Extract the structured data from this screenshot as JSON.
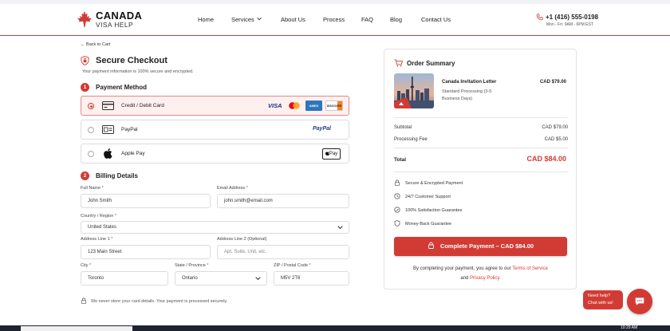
{
  "header": {
    "logo_line1": "CANADA",
    "logo_line2": "VISA HELP",
    "nav": [
      "Home",
      "Services",
      "About Us",
      "Process",
      "FAQ",
      "Blog",
      "Contact Us"
    ],
    "phone": "+1 (416) 555-0198",
    "hours": "Mon - Fri: 9AM - 6PM EST"
  },
  "checkout": {
    "back_label": "← Back to Cart",
    "title": "Secure Checkout",
    "subtitle": "Your payment information is 100% secure and encrypted.",
    "step1_num": "1",
    "step1_label": "Payment Method",
    "methods": [
      {
        "label": "Credit / Debit Card",
        "selected": true
      },
      {
        "label": "PayPal",
        "selected": false
      },
      {
        "label": "Apple Pay",
        "selected": false
      }
    ],
    "brands": {
      "visa": "VISA",
      "amex": "AMEX",
      "discover": "DISCOVER",
      "paypal": "PayPal",
      "applepay": "Pay"
    },
    "step2_num": "2",
    "step2_label": "Billing Details",
    "fields": {
      "full_name": {
        "label": "Full Name",
        "value": "John Smith"
      },
      "email": {
        "label": "Email Address",
        "value": "john.smith@email.com"
      },
      "country": {
        "label": "Country / Region",
        "value": "United States"
      },
      "address1": {
        "label": "Address Line 1",
        "value": "123 Main Street"
      },
      "address2": {
        "label": "Address Line 2 (Optional)",
        "placeholder": "Apt, Suite, Unit, etc."
      },
      "city": {
        "label": "City",
        "value": "Toronto"
      },
      "state": {
        "label": "State / Province",
        "value": "Ontario"
      },
      "postal": {
        "label": "ZIP / Postal Code",
        "value": "M5V 2T6"
      }
    },
    "required_mark": "*",
    "note": "We never store your card details. Your payment is processed securely."
  },
  "summary": {
    "title": "Order Summary",
    "product_name": "Canada Invitation Letter",
    "product_desc": "Standard Processing (3-5 Business Days)",
    "product_price": "CAD $79.00",
    "subtotal_label": "Subtotal",
    "subtotal_value": "CAD $79.00",
    "fee_label": "Processing Fee",
    "fee_value": "CAD $5.00",
    "total_label": "Total",
    "total_value": "CAD $84.00",
    "features": [
      "Secure & Encrypted Payment",
      "24/7 Customer Support",
      "100% Satisfaction Guarantee",
      "Money-Back Guarantee"
    ],
    "pay_button": "Complete Payment – CAD $84.00",
    "terms_prefix": "By completing your payment, you agree to our",
    "terms_link": "Terms of Service",
    "terms_and": "and",
    "privacy_link": "Privacy Policy."
  },
  "chat": {
    "line1": "Need help?",
    "line2": "Chat with us!"
  },
  "taskbar": {
    "time": "10:29 AM"
  },
  "colors": {
    "accent": "#d23b34",
    "border": "#dcdcdc"
  }
}
